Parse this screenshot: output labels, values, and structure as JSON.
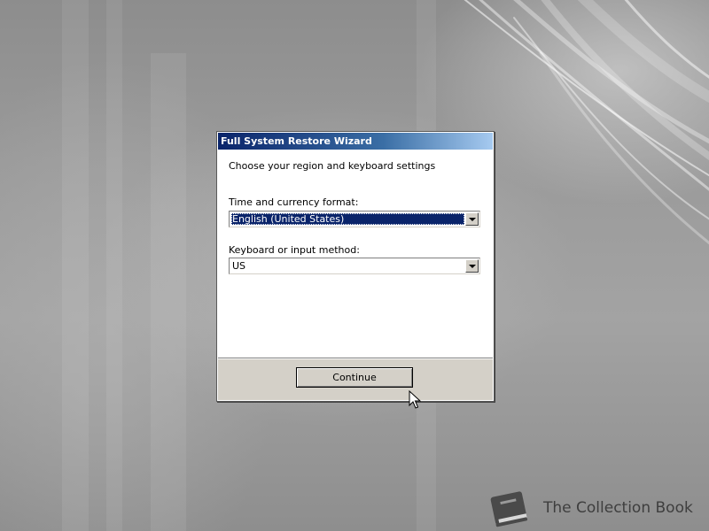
{
  "dialog": {
    "title": "Full System Restore Wizard",
    "heading": "Choose your region and keyboard settings",
    "time_currency": {
      "label": "Time and currency format:",
      "value": "English (United States)"
    },
    "keyboard": {
      "label": "Keyboard or input method:",
      "value": "US"
    },
    "continue_label": "Continue"
  },
  "watermark": {
    "text": "The Collection Book",
    "icon": "book-icon"
  },
  "colors": {
    "titlebar_start": "#0a246a",
    "titlebar_end": "#a6caf0",
    "selection": "#0a246a",
    "dialog_face": "#d4d0c8"
  }
}
